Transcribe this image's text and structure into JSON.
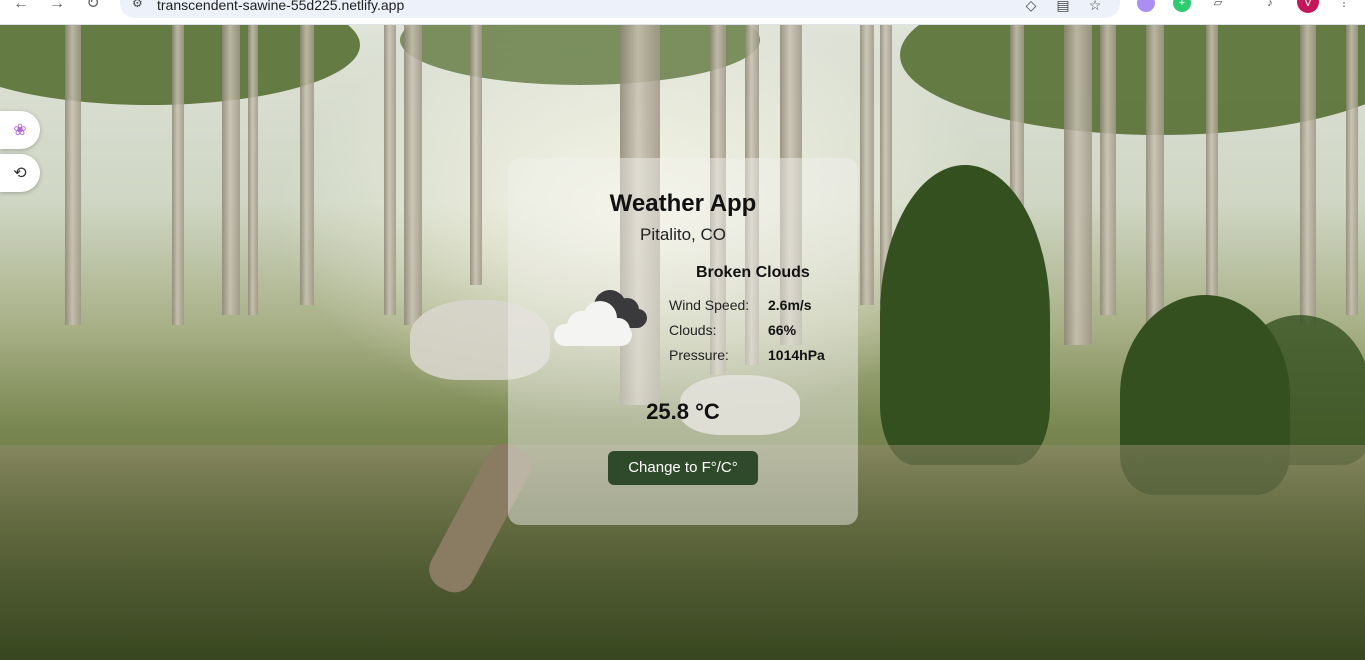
{
  "browser": {
    "url": "transcendent-sawine-55d225.netlify.app",
    "profile_initial": "V"
  },
  "app": {
    "title": "Weather App",
    "city": "Pitalito, CO",
    "condition": "Broken Clouds",
    "icon": "broken-clouds-icon",
    "details": [
      {
        "label": "Wind Speed:",
        "value": "2.6m/s"
      },
      {
        "label": "Clouds:",
        "value": "66%"
      },
      {
        "label": "Pressure:",
        "value": "1014hPa"
      }
    ],
    "temperature": "25.8 °C",
    "toggle_label": "Change to F°/C°"
  },
  "colors": {
    "button_bg": "#2f4a2a",
    "card_bg": "rgba(240,240,236,0.48)"
  }
}
